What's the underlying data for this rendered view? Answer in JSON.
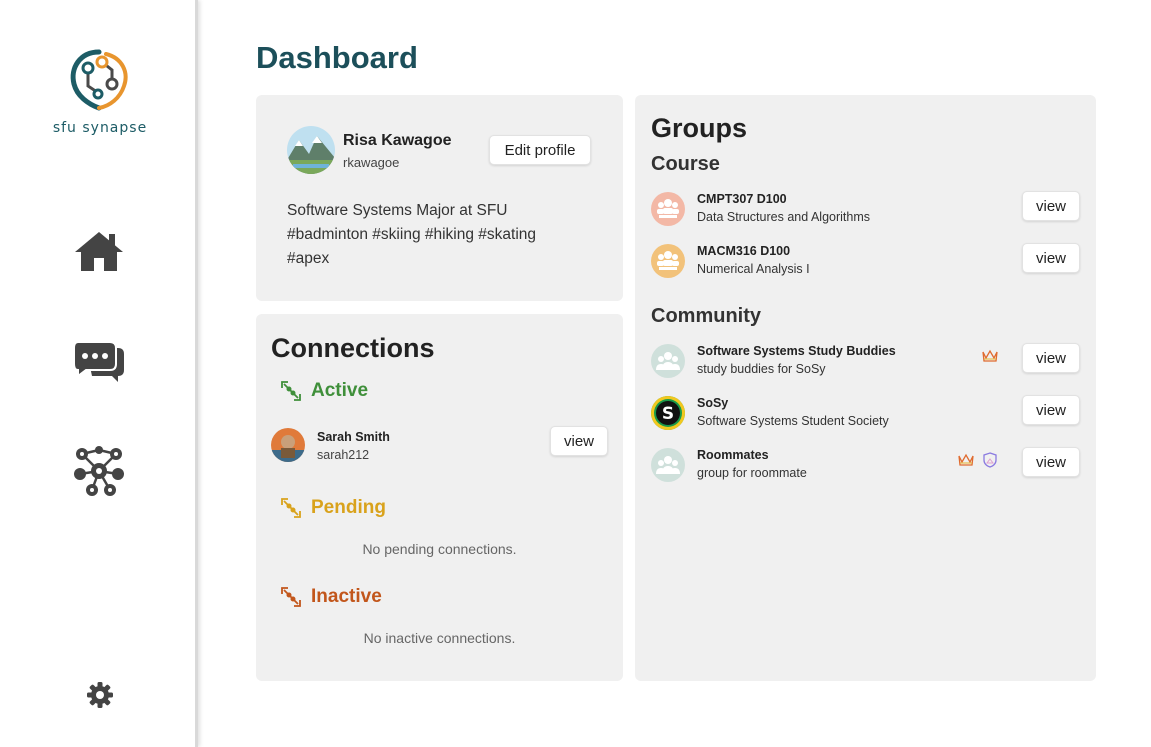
{
  "app": {
    "logo_text": "sfu synapse"
  },
  "sidebar": {
    "items": [
      {
        "name": "home",
        "icon": "home-icon"
      },
      {
        "name": "messages",
        "icon": "chat-icon"
      },
      {
        "name": "network",
        "icon": "network-icon"
      }
    ],
    "settings_icon": "gear-icon"
  },
  "page": {
    "title": "Dashboard"
  },
  "profile": {
    "name": "Risa Kawagoe",
    "username": "rkawagoe",
    "edit_label": "Edit profile",
    "bio_line1": "Software Systems Major at SFU",
    "bio_line2": "#badminton #skiing #hiking #skating",
    "bio_line3": "#apex"
  },
  "connections": {
    "title": "Connections",
    "active_label": "Active",
    "pending_label": "Pending",
    "inactive_label": "Inactive",
    "active": [
      {
        "name": "Sarah Smith",
        "username": "sarah212",
        "view_label": "view"
      }
    ],
    "pending_empty": "No pending connections.",
    "inactive_empty": "No inactive connections."
  },
  "groups": {
    "title": "Groups",
    "course_label": "Course",
    "community_label": "Community",
    "courses": [
      {
        "name": "CMPT307 D100",
        "desc": "Data Structures and Algorithms",
        "view_label": "view",
        "color": "#f3b8a6"
      },
      {
        "name": "MACM316 D100",
        "desc": "Numerical Analysis I",
        "view_label": "view",
        "color": "#f2c27a"
      }
    ],
    "community": [
      {
        "name": "Software Systems Study Buddies",
        "desc": "study buddies for SoSy",
        "view_label": "view",
        "badges": [
          "crown-icon"
        ]
      },
      {
        "name": "SoSy",
        "desc": "Software Systems Student Society",
        "view_label": "view",
        "badges": []
      },
      {
        "name": "Roommates",
        "desc": "group for roommate",
        "view_label": "view",
        "badges": [
          "crown-icon",
          "shield-icon"
        ]
      }
    ]
  },
  "colors": {
    "primary": "#1c4f5a",
    "active": "#3f8f3a",
    "pending": "#d9a21b",
    "inactive": "#c2561b",
    "card": "#f0f0f0"
  }
}
